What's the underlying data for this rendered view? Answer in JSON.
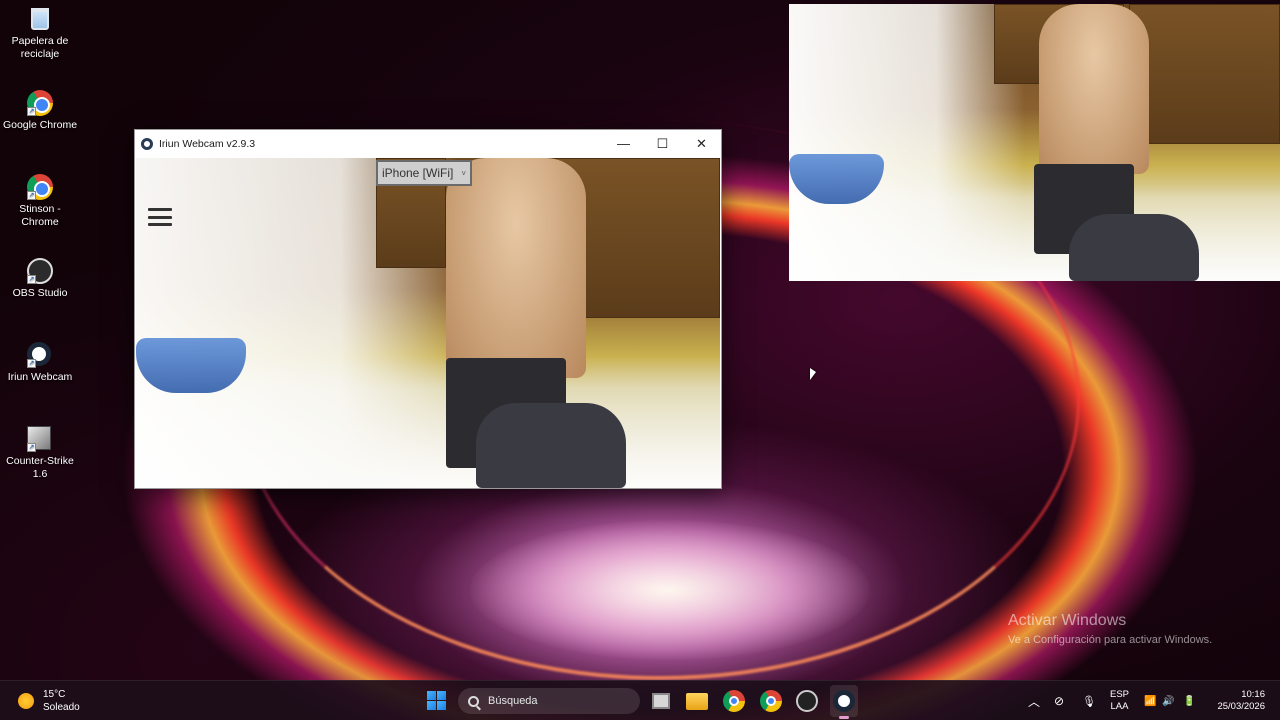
{
  "desktop": {
    "icons": [
      {
        "label": "Papelera de reciclaje",
        "icon": "recycle-bin-icon"
      },
      {
        "label": "Google Chrome",
        "icon": "chrome-icon"
      },
      {
        "label": "Stinson - Chrome",
        "icon": "chrome-profile-icon"
      },
      {
        "label": "OBS Studio",
        "icon": "obs-icon"
      },
      {
        "label": "Iriun Webcam",
        "icon": "iriun-icon"
      },
      {
        "label": "Counter-Strike 1.6",
        "icon": "counter-strike-icon"
      }
    ]
  },
  "window": {
    "title": "Iriun Webcam v2.9.3",
    "minimize": "—",
    "maximize": "☐",
    "close": "✕",
    "device_select": "iPhone [WiFi]",
    "device_caret": "˅"
  },
  "watermark": {
    "line1": "Activar Windows",
    "line2": "Ve a Configuración para activar Windows."
  },
  "taskbar": {
    "weather_temp": "15°C",
    "weather_desc": "Soleado",
    "search_placeholder": "Búsqueda",
    "lang_1": "ESP",
    "lang_2": "LAA",
    "time": "10:16",
    "date": "25/03/2026",
    "tray_chevron": "︿",
    "mic": "🎙",
    "wifi": "📶",
    "volume": "🔊",
    "battery": "🔋",
    "camera_off": "⊘"
  }
}
